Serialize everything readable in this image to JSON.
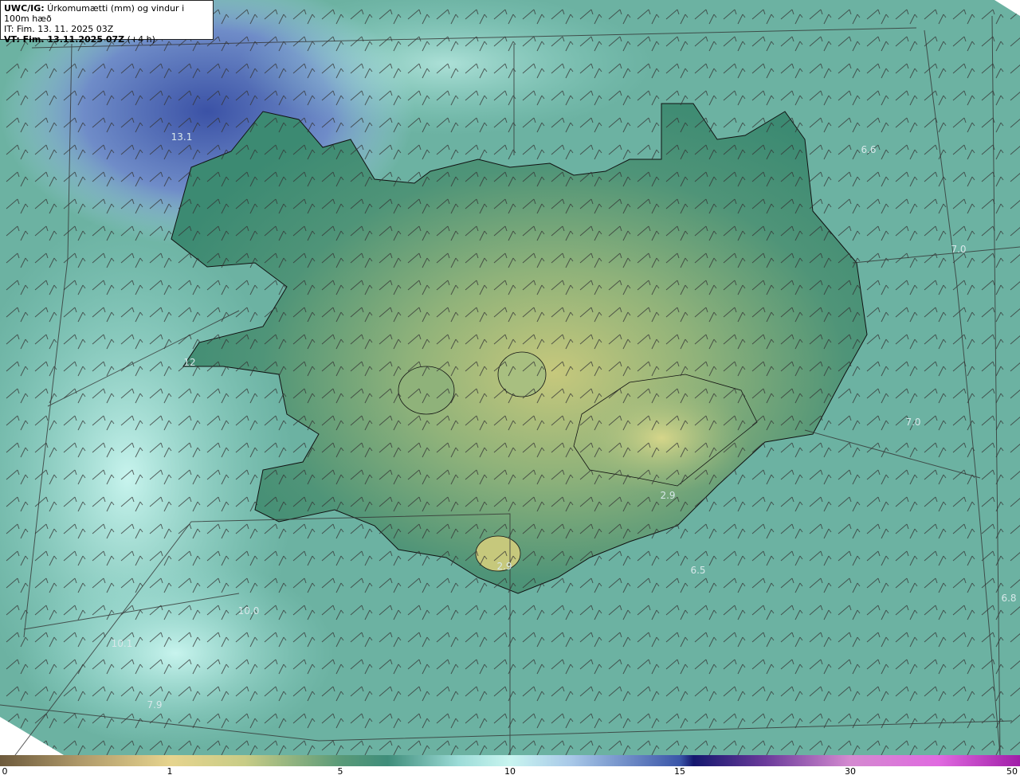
{
  "header": {
    "title_bold": "UWC/IG:",
    "title_rest": " Úrkomumætti (mm) og vindur i 100m hæð",
    "issue_time": "IT: Fim. 13. 11. 2025 03Z",
    "valid_bold": "VT: Fim. 13.11.2025 07Z",
    "valid_rest": " (+4 h)"
  },
  "value_labels": [
    {
      "id": "v1",
      "text": "13.1"
    },
    {
      "id": "v2",
      "text": "6.6"
    },
    {
      "id": "v3",
      "text": "7.0"
    },
    {
      "id": "v4",
      "text": "7.0"
    },
    {
      "id": "v5",
      "text": "6.5"
    },
    {
      "id": "v6",
      "text": "6.8"
    },
    {
      "id": "v7",
      "text": "10.0"
    },
    {
      "id": "v8",
      "text": "10.1"
    },
    {
      "id": "v9",
      "text": "7.9"
    },
    {
      "id": "v10",
      "text": "2.9"
    },
    {
      "id": "v11",
      "text": "2.9"
    },
    {
      "id": "v12",
      "text": "12"
    }
  ],
  "colorbar": {
    "ticks": [
      "0",
      "1",
      "5",
      "10",
      "15",
      "30",
      "50"
    ]
  }
}
